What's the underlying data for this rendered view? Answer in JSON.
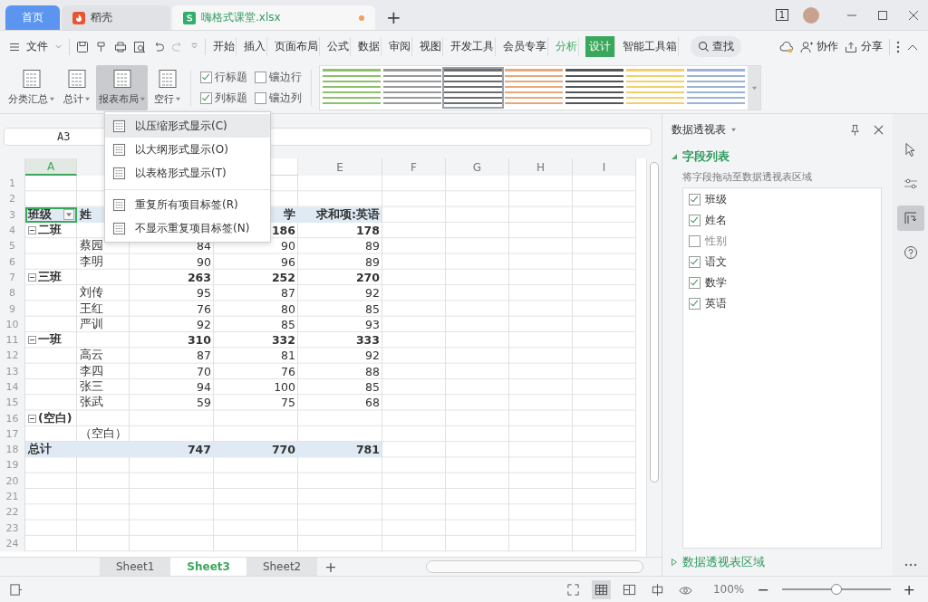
{
  "tabs": [
    {
      "kind": "home",
      "label": "首页",
      "selected": false
    },
    {
      "kind": "docer",
      "label": "稻壳",
      "selected": false
    },
    {
      "kind": "sheet",
      "label": "嗨格式课堂.xlsx",
      "selected": true,
      "modified": true
    }
  ],
  "new_tab": "+",
  "window_badge": "1",
  "menu": {
    "file": "文件",
    "tabs": [
      {
        "label": "开始",
        "contextual": false,
        "selected": false
      },
      {
        "label": "插入",
        "contextual": false,
        "selected": false
      },
      {
        "label": "页面布局",
        "contextual": false,
        "selected": false
      },
      {
        "label": "公式",
        "contextual": false,
        "selected": false
      },
      {
        "label": "数据",
        "contextual": false,
        "selected": false
      },
      {
        "label": "审阅",
        "contextual": false,
        "selected": false
      },
      {
        "label": "视图",
        "contextual": false,
        "selected": false
      },
      {
        "label": "开发工具",
        "contextual": false,
        "selected": false
      },
      {
        "label": "会员专享",
        "contextual": false,
        "selected": false
      },
      {
        "label": "分析",
        "contextual": true,
        "selected": false
      },
      {
        "label": "设计",
        "contextual": true,
        "selected": true
      },
      {
        "label": "智能工具箱",
        "contextual": false,
        "selected": false
      }
    ],
    "search": "查找",
    "collab": "协作",
    "share": "分享"
  },
  "ribbon": {
    "buttons": [
      {
        "label": "分类汇总",
        "pressed": false
      },
      {
        "label": "总计",
        "pressed": false
      },
      {
        "label": "报表布局",
        "pressed": true
      },
      {
        "label": "空行",
        "pressed": false
      }
    ],
    "options": [
      {
        "label": "行标题",
        "checked": true
      },
      {
        "label": "镶边行",
        "checked": false
      },
      {
        "label": "列标题",
        "checked": true
      },
      {
        "label": "镶边列",
        "checked": false
      }
    ],
    "styles": [
      {
        "color": "#8cc06a",
        "selected": false
      },
      {
        "color": "#9a9a9a",
        "selected": false
      },
      {
        "color": "#6e6e6e",
        "selected": true
      },
      {
        "color": "#e8a77c",
        "selected": false
      },
      {
        "color": "#555555",
        "selected": false
      },
      {
        "color": "#f2cf6c",
        "selected": false
      },
      {
        "color": "#9db3d6",
        "selected": false
      }
    ]
  },
  "name_box": "A3",
  "column_headers": {
    "A": {
      "label": "A",
      "selected": true
    },
    "B": {
      "selected": false
    },
    "E": {
      "label": "E",
      "selected": false
    },
    "F": {
      "label": "F",
      "selected": false
    },
    "G": {
      "label": "G",
      "selected": false
    },
    "H": {
      "label": "H",
      "selected": false
    },
    "I": {
      "label": "I",
      "selected": false
    }
  },
  "rows": [
    {
      "n": "1",
      "kind": "empty"
    },
    {
      "n": "2",
      "kind": "empty"
    },
    {
      "n": "3",
      "kind": "header",
      "cells": {
        "A": "班级",
        "B": "姓",
        "D": "学",
        "E": "求和项:英语"
      }
    },
    {
      "n": "4",
      "kind": "group",
      "expanded": true,
      "cells": {
        "A": "二班",
        "D": "186",
        "E": "178"
      }
    },
    {
      "n": "5",
      "kind": "item",
      "cells": {
        "B": "蔡园",
        "C": "84",
        "D": "90",
        "E": "89"
      }
    },
    {
      "n": "6",
      "kind": "item",
      "cells": {
        "B": "李明",
        "C": "90",
        "D": "96",
        "E": "89"
      }
    },
    {
      "n": "7",
      "kind": "group",
      "expanded": true,
      "cells": {
        "A": "三班",
        "C": "263",
        "D": "252",
        "E": "270"
      }
    },
    {
      "n": "8",
      "kind": "item",
      "cells": {
        "B": "刘传",
        "C": "95",
        "D": "87",
        "E": "92"
      }
    },
    {
      "n": "9",
      "kind": "item",
      "cells": {
        "B": "王红",
        "C": "76",
        "D": "80",
        "E": "85"
      }
    },
    {
      "n": "10",
      "kind": "item",
      "cells": {
        "B": "严训",
        "C": "92",
        "D": "85",
        "E": "93"
      }
    },
    {
      "n": "11",
      "kind": "group",
      "expanded": true,
      "cells": {
        "A": "一班",
        "C": "310",
        "D": "332",
        "E": "333"
      }
    },
    {
      "n": "12",
      "kind": "item",
      "cells": {
        "B": "高云",
        "C": "87",
        "D": "81",
        "E": "92"
      }
    },
    {
      "n": "13",
      "kind": "item",
      "cells": {
        "B": "李四",
        "C": "70",
        "D": "76",
        "E": "88"
      }
    },
    {
      "n": "14",
      "kind": "item",
      "cells": {
        "B": "张三",
        "C": "94",
        "D": "100",
        "E": "85"
      }
    },
    {
      "n": "15",
      "kind": "item",
      "cells": {
        "B": "张武",
        "C": "59",
        "D": "75",
        "E": "68"
      }
    },
    {
      "n": "16",
      "kind": "group",
      "expanded": true,
      "cells": {
        "A": "(空白)"
      }
    },
    {
      "n": "17",
      "kind": "item",
      "cells": {
        "B": "（空白）"
      }
    },
    {
      "n": "18",
      "kind": "total",
      "cells": {
        "A": "总计",
        "C": "747",
        "D": "770",
        "E": "781"
      }
    },
    {
      "n": "19",
      "kind": "empty"
    },
    {
      "n": "20",
      "kind": "empty"
    },
    {
      "n": "21",
      "kind": "empty"
    },
    {
      "n": "22",
      "kind": "empty"
    },
    {
      "n": "23",
      "kind": "empty"
    },
    {
      "n": "24",
      "kind": "empty"
    }
  ],
  "layout_menu": {
    "items": [
      {
        "label": "以压缩形式显示(C)",
        "selected": true,
        "separator_before": false
      },
      {
        "label": "以大纲形式显示(O)",
        "selected": false,
        "separator_before": false
      },
      {
        "label": "以表格形式显示(T)",
        "selected": false,
        "separator_before": false
      },
      {
        "label": "重复所有项目标签(R)",
        "selected": false,
        "separator_before": true
      },
      {
        "label": "不显示重复项目标签(N)",
        "selected": false,
        "separator_before": false
      }
    ]
  },
  "sheets": [
    {
      "label": "Sheet1",
      "selected": false
    },
    {
      "label": "Sheet3",
      "selected": true
    },
    {
      "label": "Sheet2",
      "selected": false
    }
  ],
  "add_sheet": "+",
  "pivot_pane": {
    "title": "数据透视表",
    "section": "字段列表",
    "hint": "将字段拖动至数据透视表区域",
    "fields": [
      {
        "label": "班级",
        "checked": true
      },
      {
        "label": "姓名",
        "checked": true
      },
      {
        "label": "性别",
        "checked": false
      },
      {
        "label": "语文",
        "checked": true
      },
      {
        "label": "数学",
        "checked": true
      },
      {
        "label": "英语",
        "checked": true
      }
    ],
    "areas": "数据透视表区域"
  },
  "side_tools": [
    {
      "kind": "select",
      "selected": false
    },
    {
      "kind": "settings",
      "selected": false
    },
    {
      "kind": "pivot",
      "selected": true
    },
    {
      "kind": "help",
      "selected": false
    }
  ],
  "status": {
    "views": [
      {
        "kind": "fullscreen",
        "selected": false
      },
      {
        "kind": "normal",
        "selected": true
      },
      {
        "kind": "page",
        "selected": false
      },
      {
        "kind": "split",
        "selected": false
      },
      {
        "kind": "eye",
        "selected": false
      }
    ],
    "zoom": "100%",
    "zoom_out": "−",
    "zoom_in": "+",
    "zoom_slider": {
      "level": 0.5
    }
  }
}
